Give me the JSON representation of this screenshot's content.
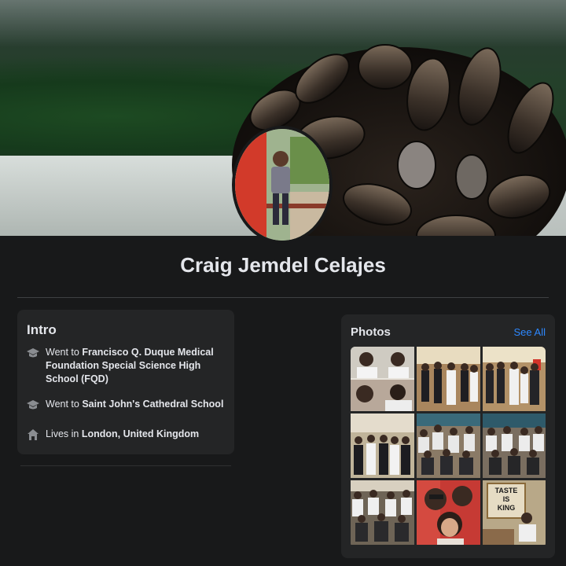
{
  "profile": {
    "name": "Craig Jemdel Celajes"
  },
  "intro": {
    "title": "Intro",
    "items": [
      {
        "icon": "graduation-cap-icon",
        "prefix": "Went to ",
        "bold": "Francisco Q. Duque Medical Foundation Special Science High School (FQD)"
      },
      {
        "icon": "graduation-cap-icon",
        "prefix": "Went to ",
        "bold": "Saint John's Cathedral School"
      },
      {
        "icon": "home-icon",
        "prefix": "Lives in ",
        "bold": "London, United Kingdom"
      }
    ]
  },
  "photos": {
    "title": "Photos",
    "see_all": "See All",
    "tile_texts": {
      "taste_sign": "TASTE IS KING"
    }
  },
  "colors": {
    "background": "#18191a",
    "card": "#242526",
    "text": "#e4e6eb",
    "link": "#2d88ff",
    "divider": "#3e4042"
  }
}
